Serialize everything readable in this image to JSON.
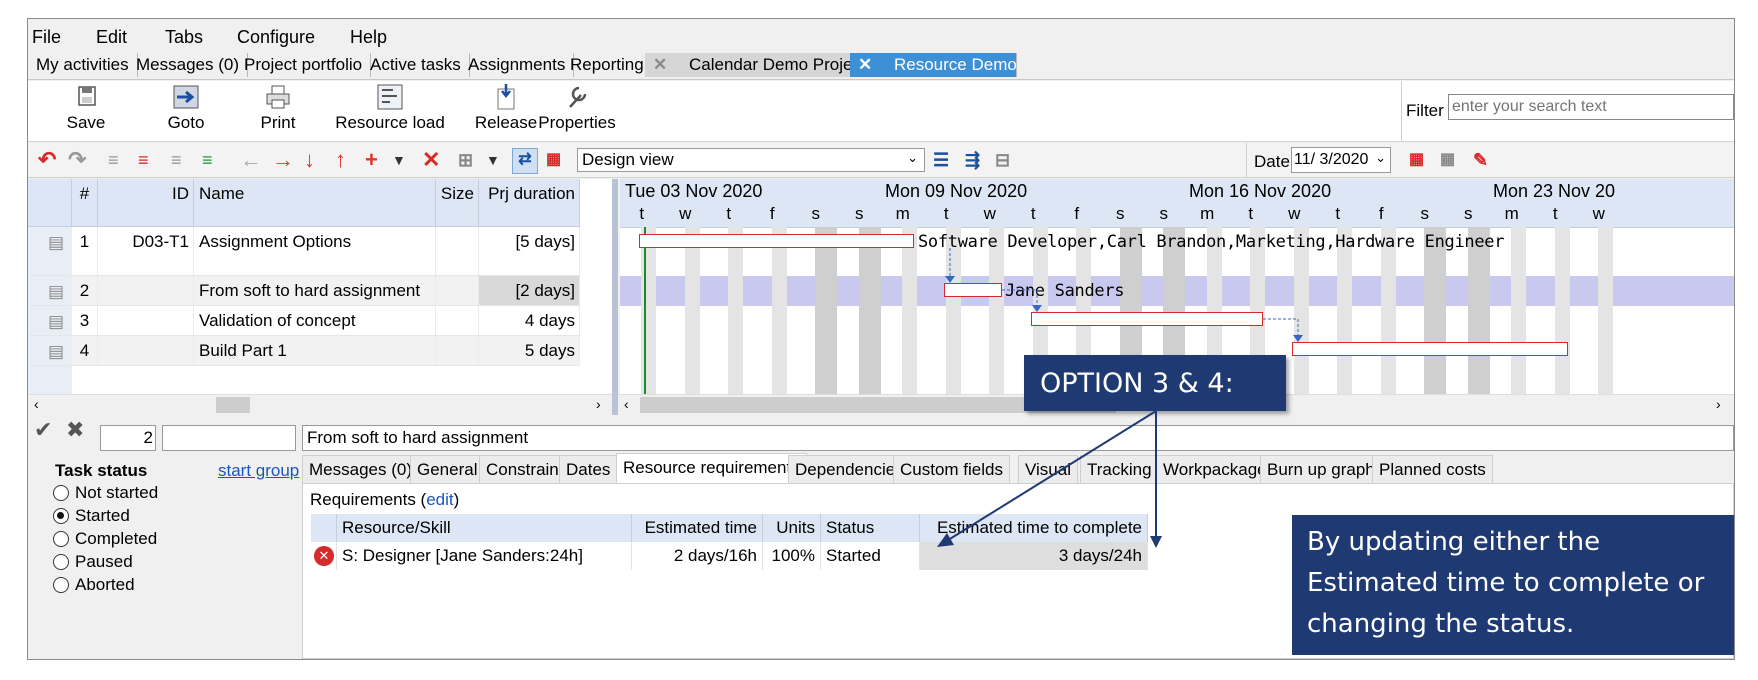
{
  "menu": [
    "File",
    "Edit",
    "Tabs",
    "Configure",
    "Help"
  ],
  "doc_tabs": [
    "My activities",
    "Messages (0)",
    "Project portfolio",
    "Active tasks",
    "Assignments",
    "Reporting",
    "Calendar Demo Project",
    "Resource Demo"
  ],
  "toolbar": {
    "save": "Save",
    "goto": "Goto",
    "print": "Print",
    "resource_load": "Resource load",
    "release": "Release",
    "properties": "Properties",
    "filter_label": "Filter",
    "filter_placeholder": "enter your search text",
    "view_select": "Design view",
    "date_label": "Date",
    "date_value": "11/ 3/2020"
  },
  "grid": {
    "headers": {
      "num": "#",
      "id": "ID",
      "name": "Name",
      "size": "Size",
      "duration": "Prj duration"
    },
    "rows": [
      {
        "num": "1",
        "id": "D03-T1",
        "name": "Assignment Options",
        "size": "",
        "duration": "[5 days]"
      },
      {
        "num": "2",
        "id": "",
        "name": "From soft to hard assignment",
        "size": "",
        "duration": "[2 days]"
      },
      {
        "num": "3",
        "id": "",
        "name": "Validation of concept",
        "size": "",
        "duration": "4 days"
      },
      {
        "num": "4",
        "id": "",
        "name": "Build Part 1",
        "size": "",
        "duration": "5 days"
      }
    ]
  },
  "gantt": {
    "weeks": [
      "Tue 03 Nov 2020",
      "Mon 09 Nov 2020",
      "Mon 16 Nov 2020",
      "Mon 23 Nov 20"
    ],
    "days": [
      "t",
      "w",
      "t",
      "f",
      "s",
      "s",
      "m",
      "t",
      "w",
      "t",
      "f",
      "s",
      "s",
      "m",
      "t",
      "w",
      "t",
      "f",
      "s",
      "s",
      "m",
      "t",
      "w"
    ],
    "bar_labels": [
      "Software Developer,Carl Brandon,Marketing,Hardware Engineer",
      "Jane Sanders"
    ]
  },
  "detail": {
    "row_number": "2",
    "task_name": "From soft to hard assignment",
    "status_title": "Task status",
    "start_group": "start group",
    "statuses": [
      "Not started",
      "Started",
      "Completed",
      "Paused",
      "Aborted"
    ],
    "selected_status": "Started",
    "tabs": [
      "Messages (0)",
      "General",
      "Constraint",
      "Dates",
      "Resource requirements",
      "Dependencies",
      "Custom fields",
      "Visual",
      "Tracking",
      "Workpackage",
      "Burn up graph",
      "Planned costs"
    ],
    "requirements_label": "Requirements (",
    "edit_link": "edit",
    "requirements_close": ")",
    "req_headers": [
      "Resource/Skill",
      "Estimated time",
      "Units",
      "Status",
      "Estimated time to complete"
    ],
    "req_row": {
      "skill": "S: Designer [Jane Sanders:24h]",
      "estimated": "2 days/16h",
      "units": "100%",
      "status": "Started",
      "etc": "3 days/24h"
    }
  },
  "callouts": {
    "option": "OPTION 3 & 4:",
    "explanation_lines": [
      "By updating either the",
      "Estimated time to complete or",
      "changing the status."
    ]
  },
  "colors": {
    "callout_bg": "#1f3a73",
    "active_tab": "#3d8fd6",
    "bar_border": "#d62a2a",
    "header_bg": "#dce6f4",
    "selected_row": "#c8c8ec"
  }
}
